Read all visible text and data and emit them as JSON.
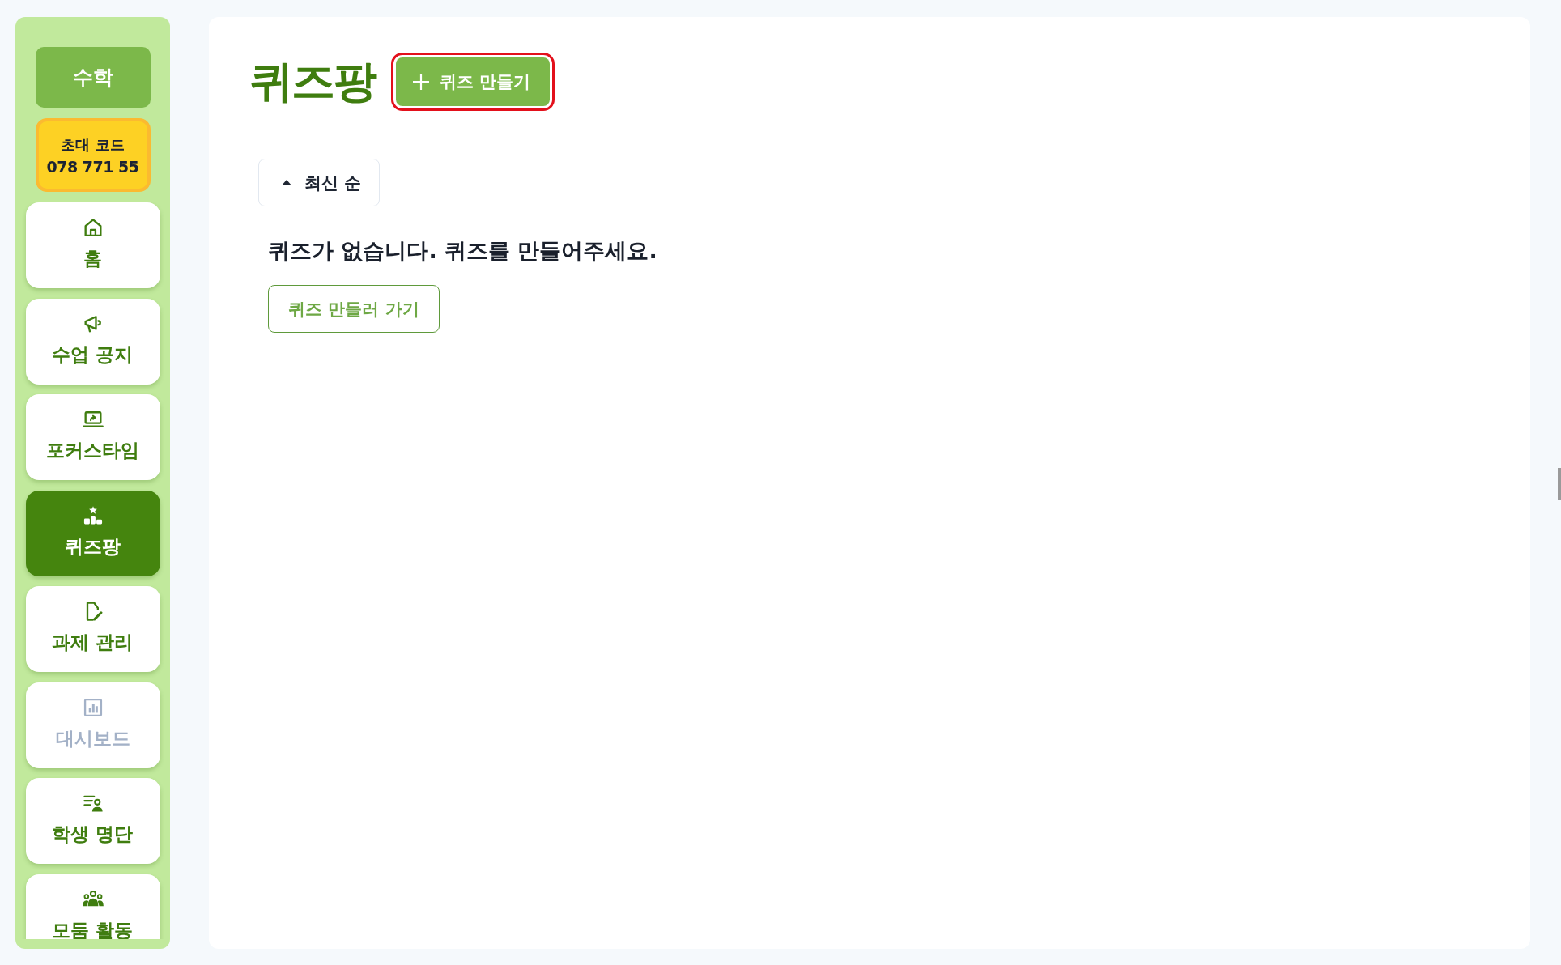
{
  "sidebar": {
    "subject": "수학",
    "invite": {
      "label": "초대 코드",
      "code": "078 771 55"
    },
    "items": [
      {
        "label": "홈",
        "selected": false,
        "disabled": false
      },
      {
        "label": "수업 공지",
        "selected": false,
        "disabled": false
      },
      {
        "label": "포커스타임",
        "selected": false,
        "disabled": false
      },
      {
        "label": "퀴즈팡",
        "selected": true,
        "disabled": false
      },
      {
        "label": "과제 관리",
        "selected": false,
        "disabled": false
      },
      {
        "label": "대시보드",
        "selected": false,
        "disabled": true
      },
      {
        "label": "학생 명단",
        "selected": false,
        "disabled": false
      },
      {
        "label": "모둠 활동",
        "selected": false,
        "disabled": false
      }
    ]
  },
  "main": {
    "title": "퀴즈팡",
    "create_button": {
      "label": "퀴즈 만들기",
      "highlighted": true
    },
    "sort": {
      "label": "최신 순"
    },
    "empty_message": "퀴즈가 없습니다. 퀴즈를 만들어주세요.",
    "empty_action": "퀴즈 만들러 가기"
  }
}
